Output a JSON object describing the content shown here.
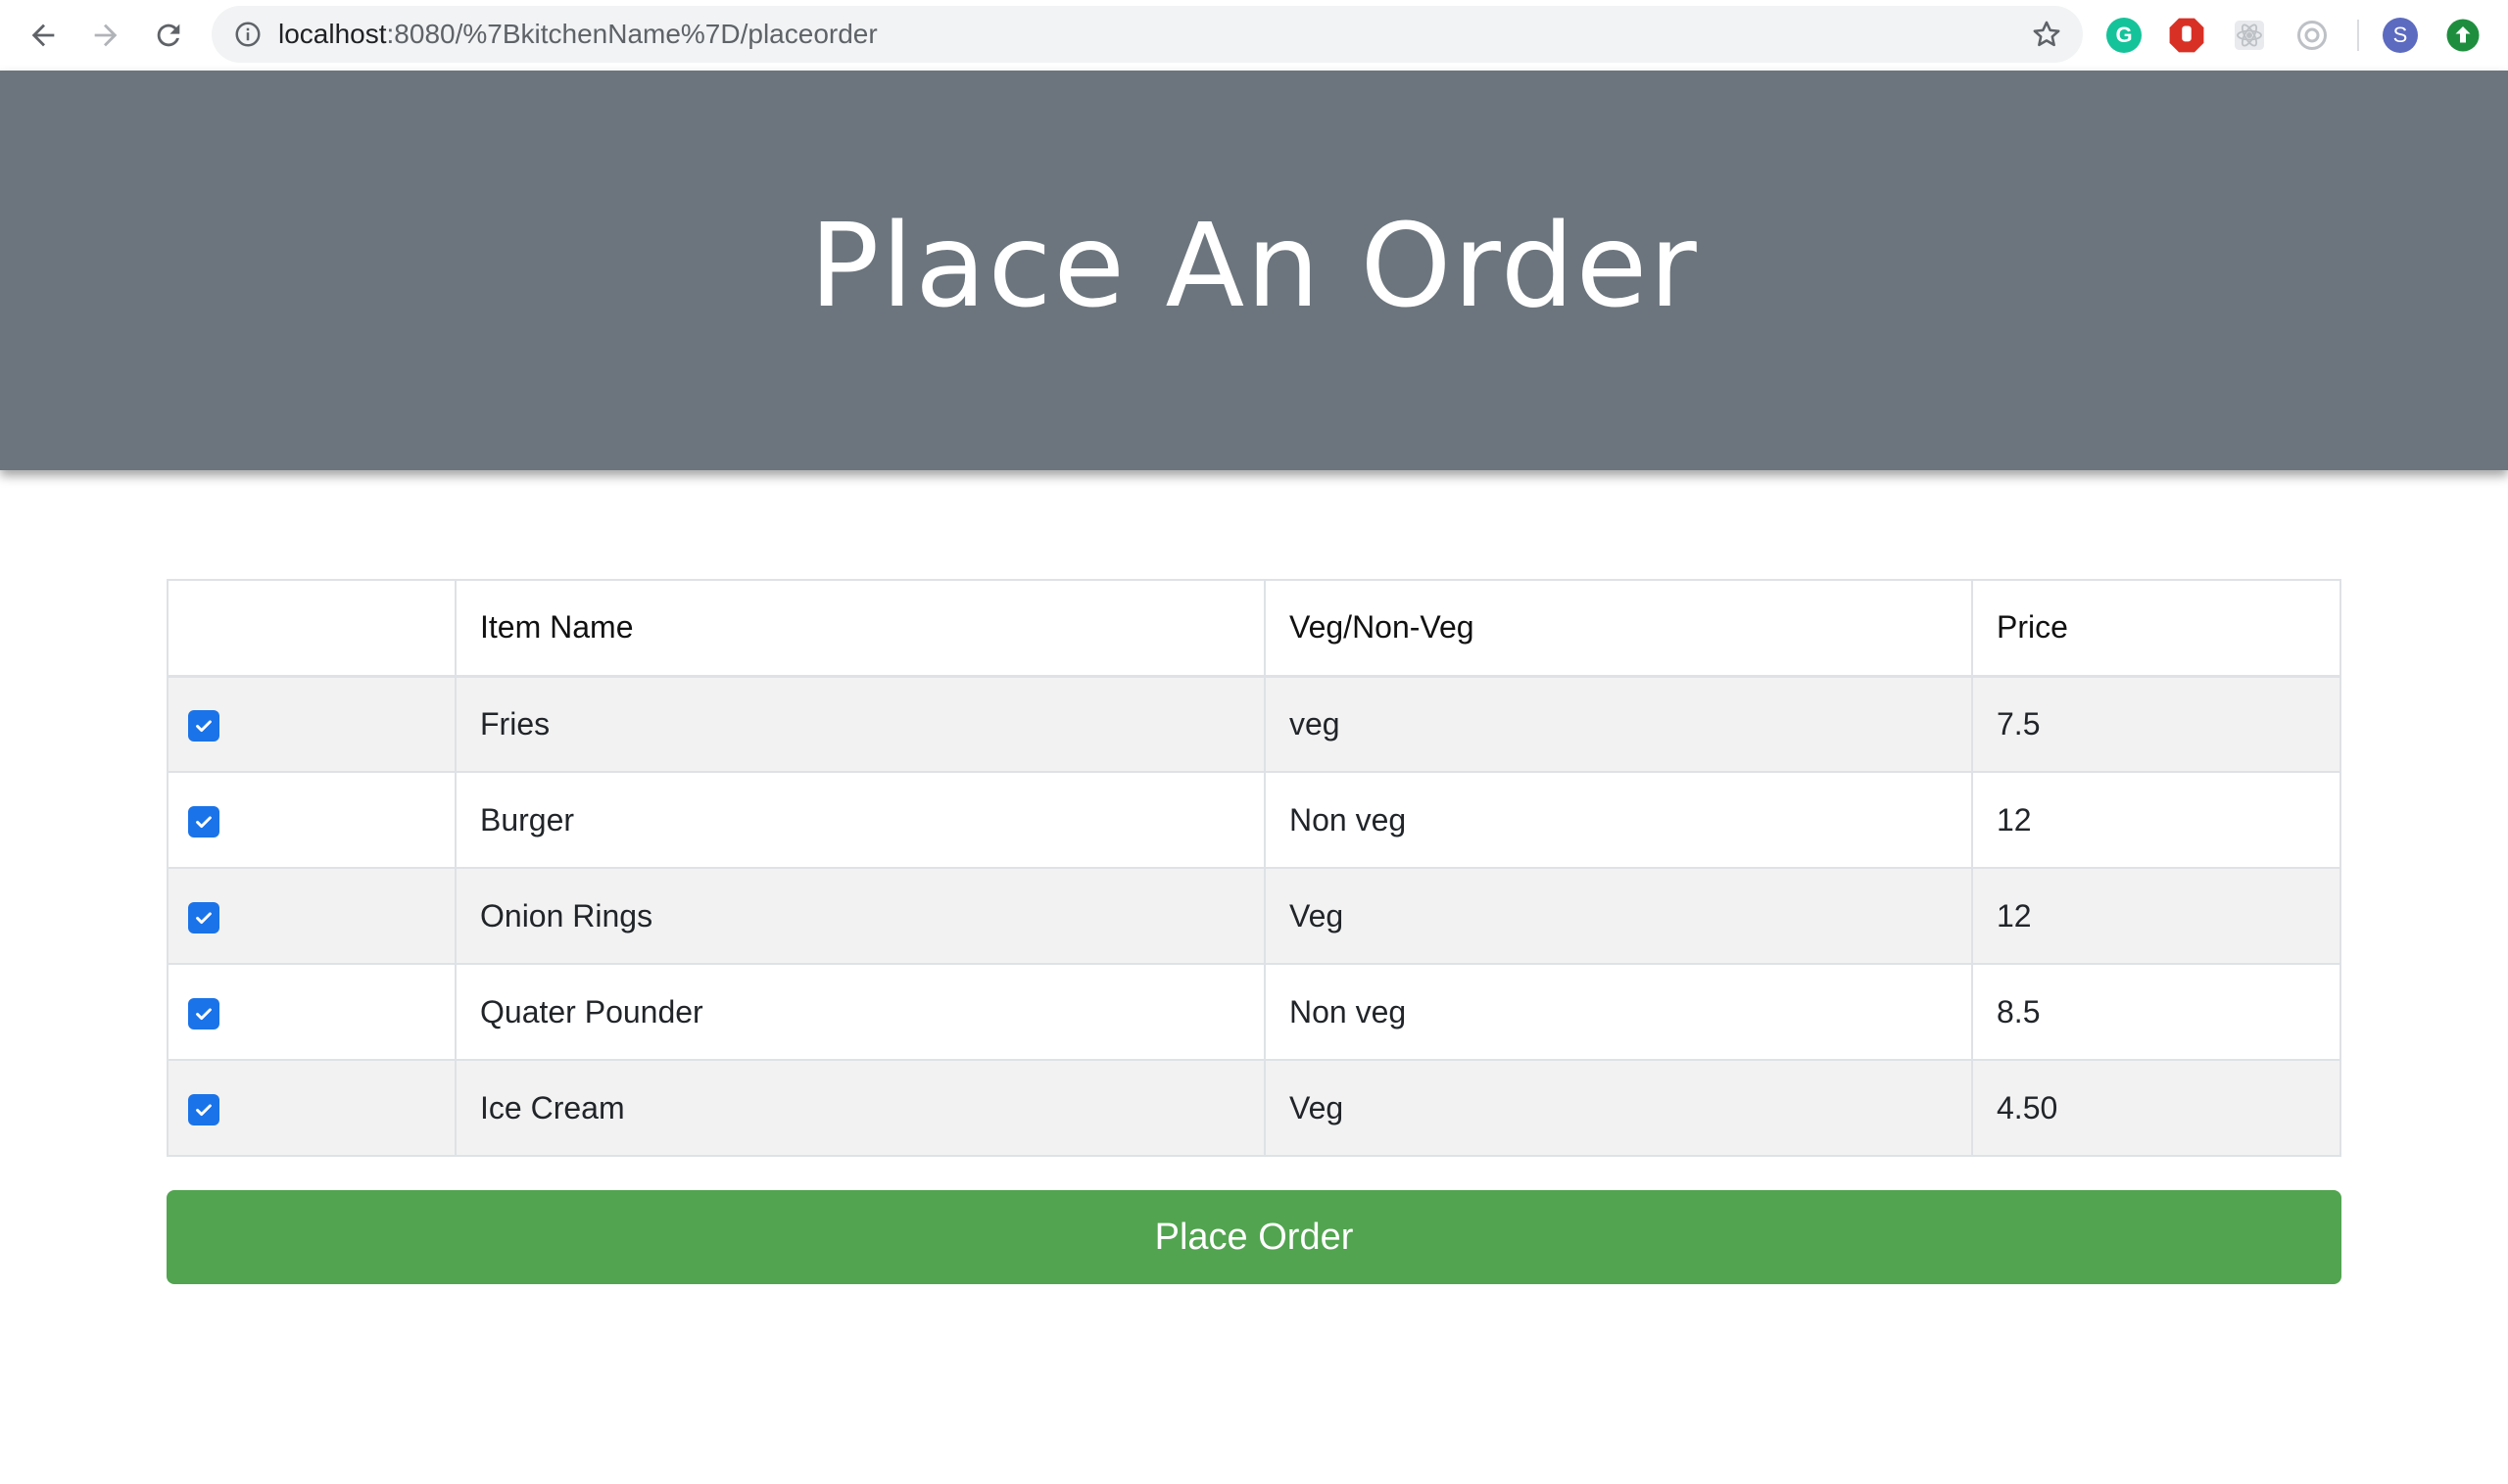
{
  "browser": {
    "url_host": "localhost",
    "url_path": ":8080/%7BkitchenName%7D/placeorder",
    "profile_initial": "S"
  },
  "page": {
    "title": "Place An Order"
  },
  "table": {
    "headers": [
      "",
      "Item Name",
      "Veg/Non-Veg",
      "Price"
    ],
    "rows": [
      {
        "checked": true,
        "name": "Fries",
        "type": "veg",
        "price": "7.5"
      },
      {
        "checked": true,
        "name": "Burger",
        "type": "Non veg",
        "price": "12"
      },
      {
        "checked": true,
        "name": "Onion Rings",
        "type": "Veg",
        "price": "12"
      },
      {
        "checked": true,
        "name": "Quater Pounder",
        "type": "Non veg",
        "price": "8.5"
      },
      {
        "checked": true,
        "name": "Ice Cream",
        "type": "Veg",
        "price": "4.50"
      }
    ]
  },
  "actions": {
    "place_order_label": "Place Order"
  },
  "colors": {
    "header_bg": "#6c757d",
    "button_bg": "#52a450",
    "checkbox": "#1a73e8",
    "row_stripe": "#f2f2f2"
  }
}
